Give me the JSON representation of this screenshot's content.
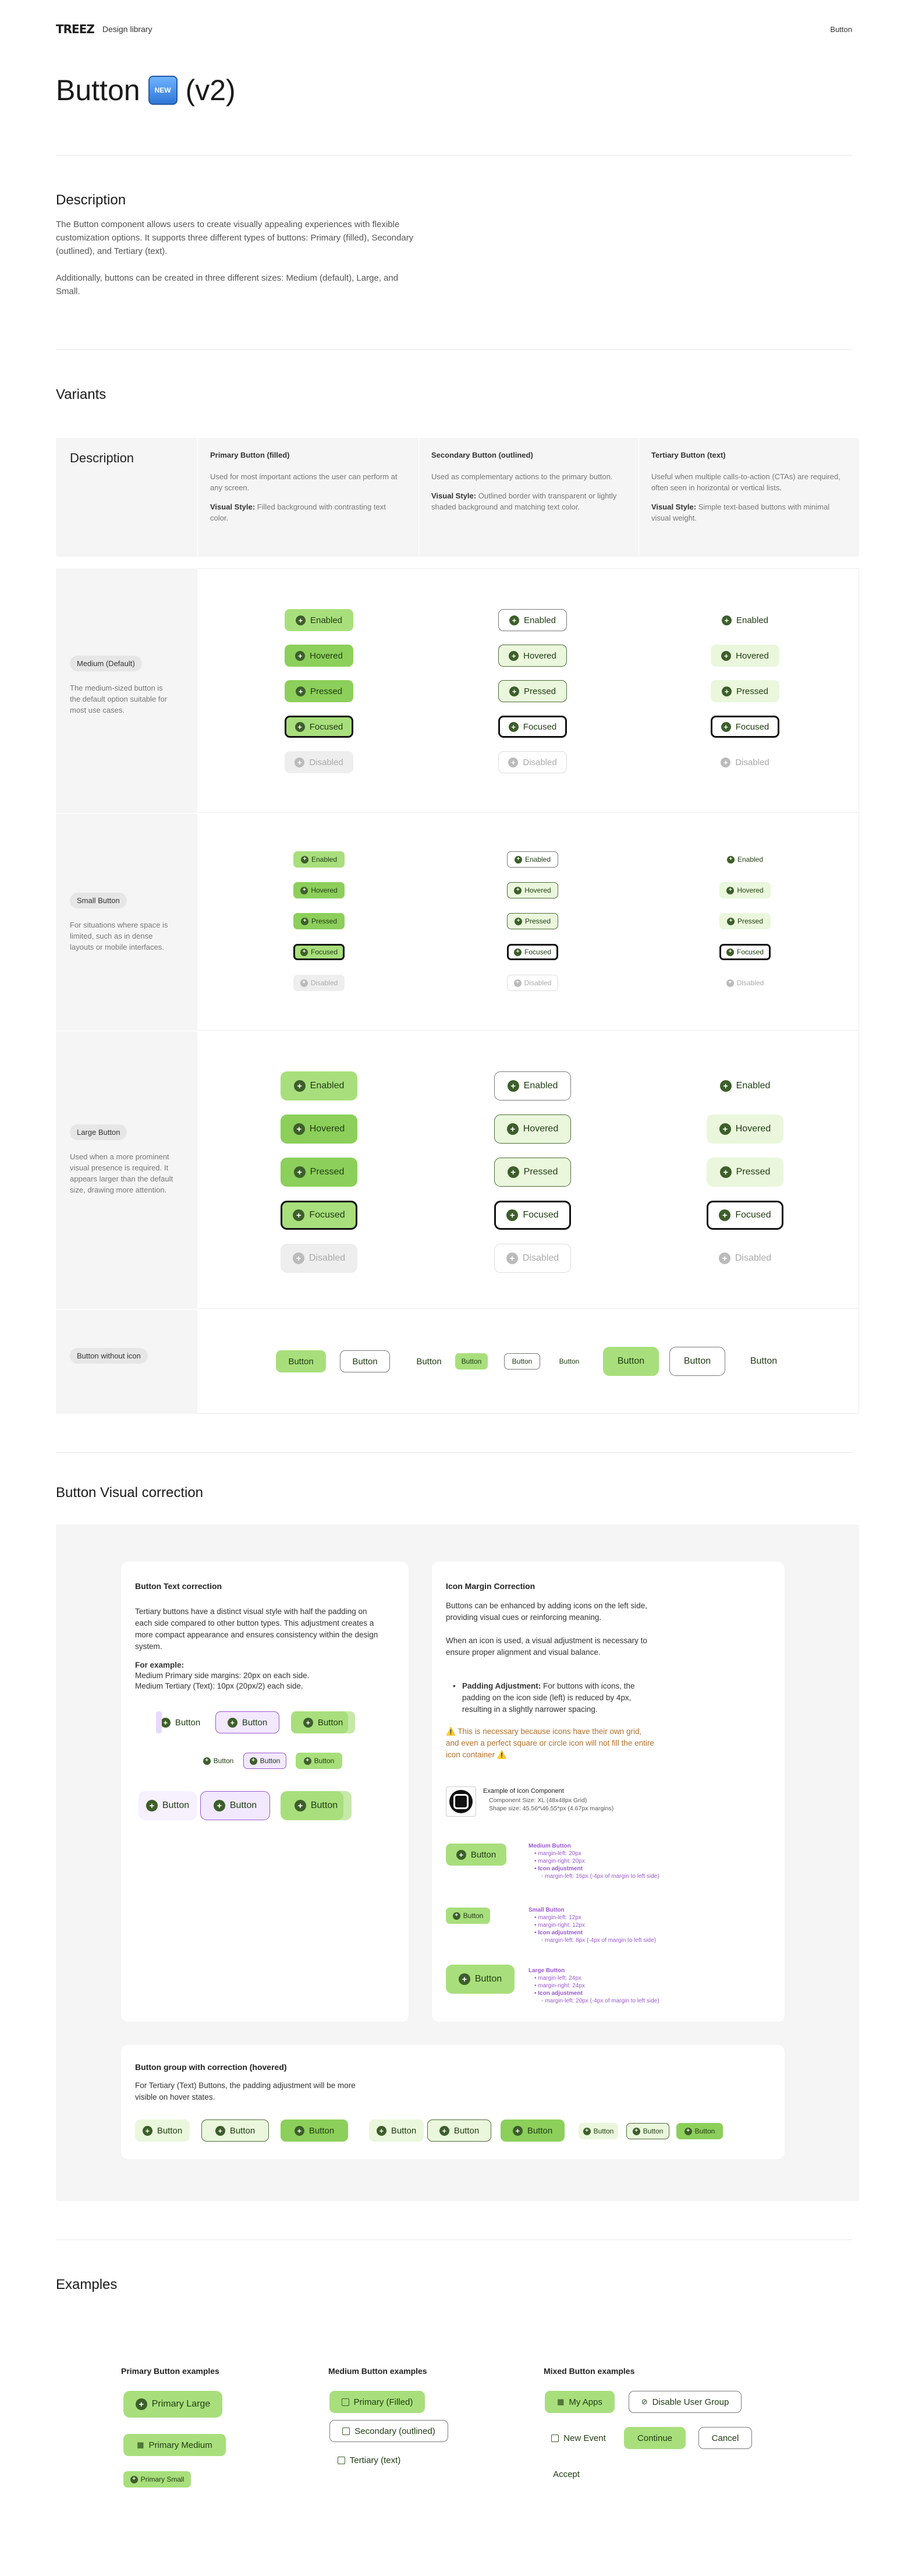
{
  "topbar": {
    "logo": "TREEZ",
    "library": "Design library",
    "current": "Button"
  },
  "title": "Button",
  "title_suffix": "(v2)",
  "new_badge": "NEW",
  "description": {
    "heading": "Description",
    "p1": "The Button component allows users to create visually appealing experiences with flexible customization options. It supports three different types of buttons: Primary (filled), Secondary (outlined), and Tertiary (text).",
    "p2": "Additionally, buttons can be created in three different sizes: Medium (default), Large, and Small."
  },
  "variants": {
    "heading": "Variants",
    "table_title": "Description",
    "cols": [
      {
        "title": "Primary Button (filled)",
        "desc": "Used for most important actions the user can perform at any screen.",
        "vs_label": "Visual Style:",
        "vs": " Filled background with contrasting text color."
      },
      {
        "title": "Secondary Button (outlined)",
        "desc": "Used as complementary actions to the primary button.",
        "vs_label": "Visual Style:",
        "vs": " Outlined border with transparent or lightly shaded background and matching text color."
      },
      {
        "title": "Tertiary Button (text)",
        "desc": "Useful when multiple calls-to-action (CTAs) are required, often seen in horizontal or vertical lists.",
        "vs_label": "Visual Style:",
        "vs": " Simple text-based buttons with minimal visual weight."
      }
    ],
    "rows": [
      {
        "tag": "Medium (Default)",
        "desc": "The medium-sized button is the default option suitable for most use cases."
      },
      {
        "tag": "Small Button",
        "desc": "For situations where space is limited, such as in dense layouts or mobile interfaces."
      },
      {
        "tag": "Large Button",
        "desc": "Used when a more prominent visual presence is required. It appears larger than the default size, drawing more attention."
      },
      {
        "tag": "Button without icon",
        "desc": ""
      }
    ],
    "states": [
      "Enabled",
      "Hovered",
      "Pressed",
      "Focused",
      "Disabled"
    ],
    "noicon_label": "Button"
  },
  "correction": {
    "heading": "Button Visual correction",
    "text_card": {
      "title": "Button Text correction",
      "p1": "Tertiary buttons have a distinct visual style with half the padding on each side compared to other button types. This adjustment creates a more compact appearance and ensures consistency within the design system.",
      "ex_label": "For example:",
      "ex1": "Medium Primary side margins: 20px on each side.",
      "ex2": "Medium Tertiary (Text): 10px (20px/2) each side.",
      "btn": "Button"
    },
    "icon_card": {
      "title": "Icon Margin Correction",
      "p1": "Buttons can be enhanced by adding icons on the left side, providing visual cues or reinforcing meaning.",
      "p2": "When an icon is used, a visual adjustment is necessary to ensure proper alignment and visual balance.",
      "bullet_label": "Padding Adjustment:",
      "bullet": " For buttons with icons, the padding on the icon side (left) is reduced by 4px, resulting in a slightly narrower spacing.",
      "warn": "⚠️ This is necessary because icons have their own grid, and even a perfect square or circle icon will not fill the entire icon container ⚠️",
      "ex_title": "Example of Icon Component",
      "ex_l1": "Component Size: XL (48x48px Grid)",
      "ex_l2": "Shape size: 45.56*\\46.55*px (4.67px margins)",
      "specs": [
        {
          "title": "Medium Button",
          "l1": "margin-left: 20px",
          "l2": "margin-right: 20px",
          "l3": "Icon adjustment",
          "l4": "margin-left: 16px (-4px of margin to left side)"
        },
        {
          "title": "Small Button",
          "l1": "margin-left: 12px",
          "l2": "margin-right: 12px",
          "l3": "Icon adjustment",
          "l4": "margin-left: 8px (-4px of margin to left side)"
        },
        {
          "title": "Large Button",
          "l1": "margin-left: 24px",
          "l2": "margin-right: 24px",
          "l3": "Icon adjustment",
          "l4": "margin-left: 20px (-4px of margin to left side)"
        }
      ],
      "btn": "Button"
    },
    "group_card": {
      "title": "Button group with correction (hovered)",
      "p1": "For Tertiary (Text) Buttons, the padding adjustment will be more visible on hover states.",
      "btn": "Button"
    }
  },
  "examples": {
    "heading": "Examples",
    "primary": {
      "title": "Primary Button examples",
      "b1": "Primary Large",
      "b2": "Primary Medium",
      "b3": "Primary Small"
    },
    "medium": {
      "title": "Medium Button examples",
      "b1": "Primary (Filled)",
      "b2": "Secondary (outlined)",
      "b3": "Tertiary (text)"
    },
    "mixed": {
      "title": "Mixed Button examples",
      "b1": "My Apps",
      "b2": "Disable User Group",
      "b3": "New Event",
      "b4": "Continue",
      "b5": "Cancel",
      "b6": "Accept"
    }
  },
  "colors": {
    "primary": "#a8df7c",
    "primary_hover": "#8ccf5a",
    "secondary_hover_bg": "#eaf7dc",
    "icon": "#3d5e2a",
    "purple": "#9b59d0",
    "warning": "#b3702b"
  }
}
